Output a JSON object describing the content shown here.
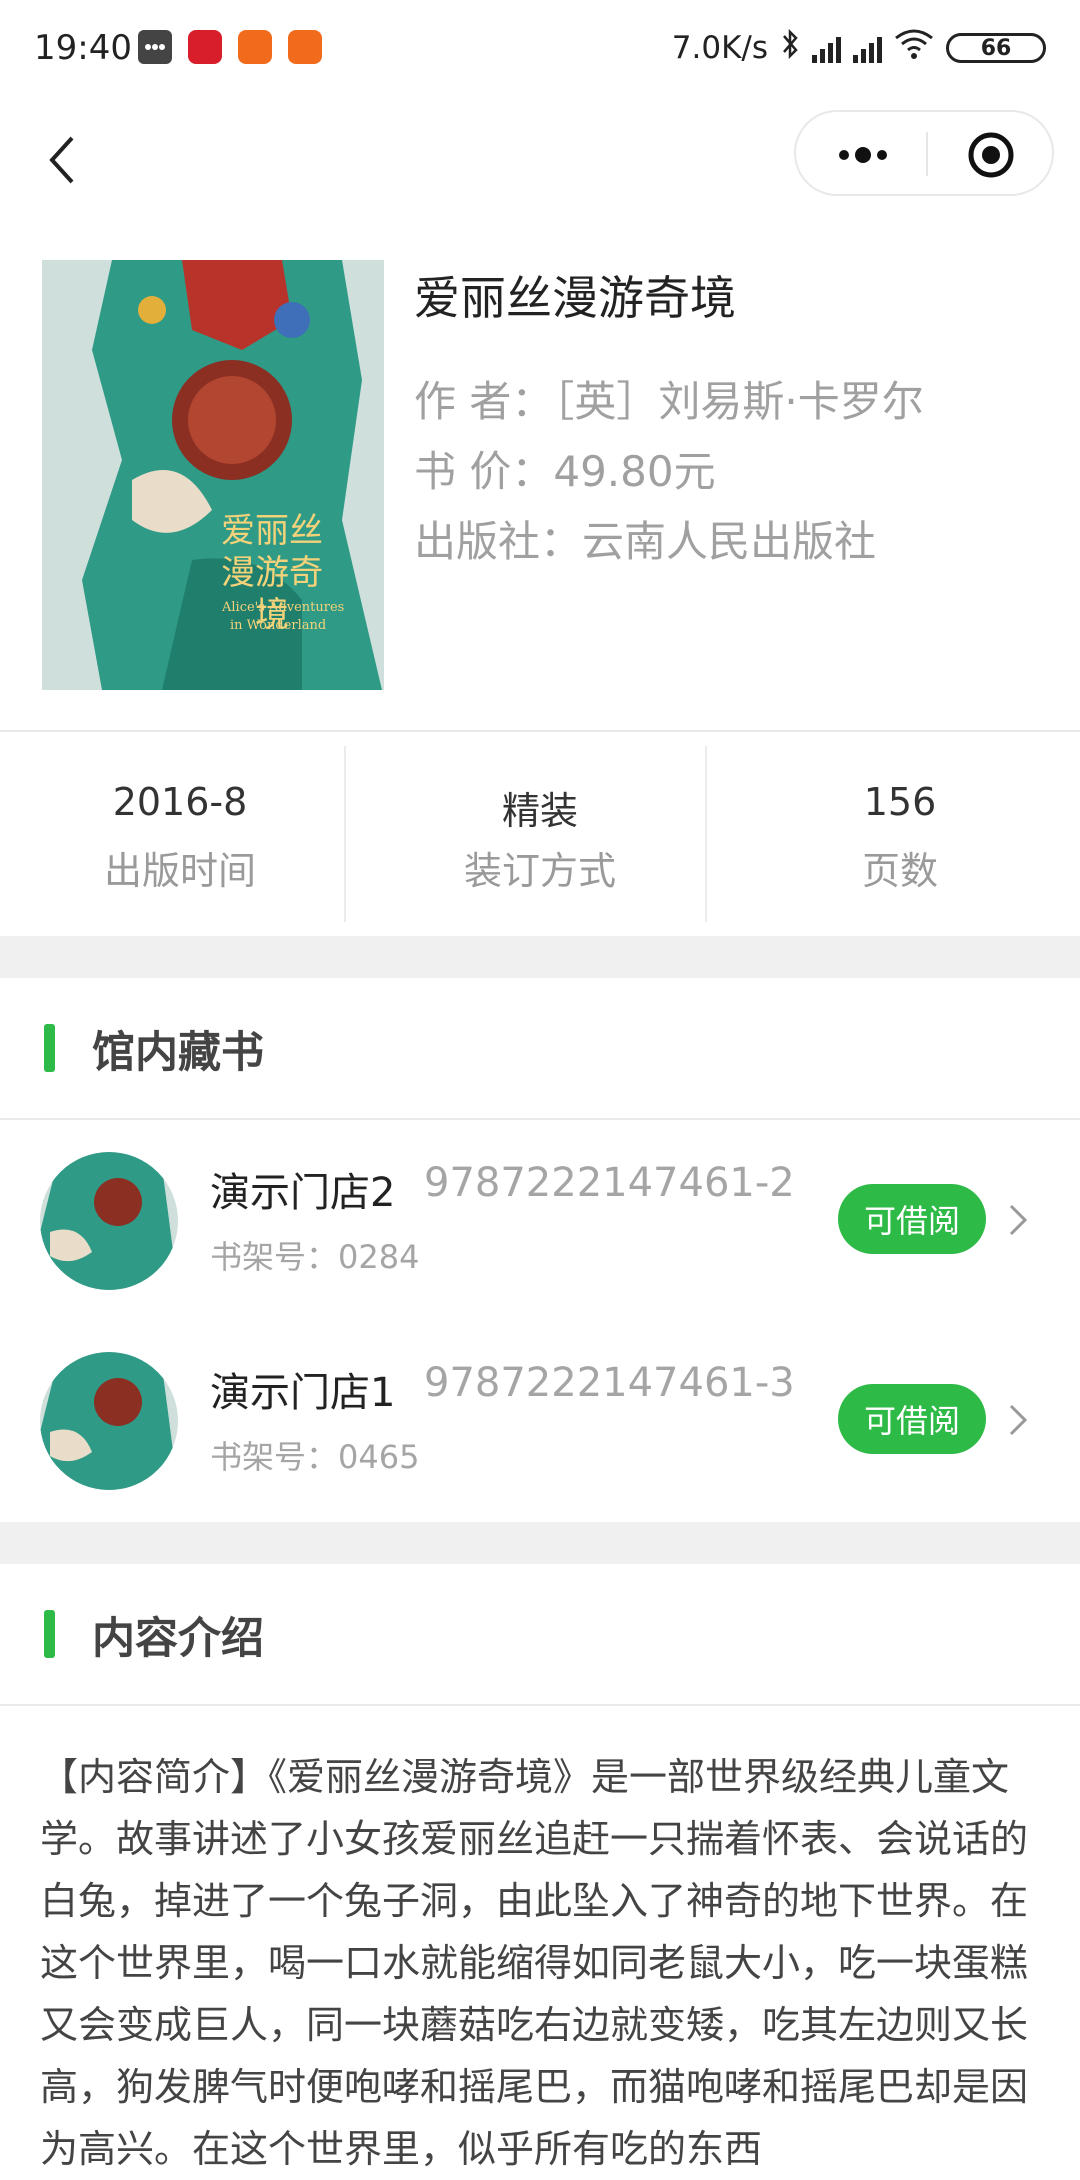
{
  "status_bar": {
    "time": "19:40",
    "network_speed": "7.0K/s",
    "battery": "66",
    "notification_icons": [
      "message-icon",
      "netease-icon",
      "mi-icon",
      "mi-icon"
    ]
  },
  "nav": {
    "back_icon": "chevron-left-icon",
    "menu_icon": "more-dots-icon",
    "close_icon": "target-icon"
  },
  "book": {
    "title": "爱丽丝漫游奇境",
    "author": "作 者：［英］刘易斯·卡罗尔",
    "price": "书 价：49.80元",
    "publisher": "出版社：云南人民出版社",
    "cover": {
      "title_cn": "爱丽丝漫游奇境",
      "title_en_1": "Alice's Adventures",
      "title_en_2": "in Wonderland"
    }
  },
  "stats": [
    {
      "value": "2016-8",
      "label": "出版时间"
    },
    {
      "value": "精装",
      "label": "装订方式"
    },
    {
      "value": "156",
      "label": "页数"
    }
  ],
  "holdings": {
    "title": "馆内藏书",
    "items": [
      {
        "branch": "演示门店2",
        "code": "9787222147461-2",
        "shelf": "书架号：0284",
        "status": "可借阅"
      },
      {
        "branch": "演示门店1",
        "code": "9787222147461-3",
        "shelf": "书架号：0465",
        "status": "可借阅"
      }
    ]
  },
  "intro": {
    "title": "内容介绍",
    "text": "【内容简介】《爱丽丝漫游奇境》是一部世界级经典儿童文学。故事讲述了小女孩爱丽丝追赶一只揣着怀表、会说话的白兔，掉进了一个兔子洞，由此坠入了神奇的地下世界。在这个世界里，喝一口水就能缩得如同老鼠大小，吃一块蛋糕又会变成巨人，同一块蘑菇吃右边就变矮，吃其左边则又长高，狗发脾气时便咆哮和摇尾巴，而猫咆哮和摇尾巴却是因为高兴。在这个世界里，似乎所有吃的东西"
  },
  "colors": {
    "accent": "#2dba46",
    "divider": "#e9e9e9",
    "section_gap": "#f0f0f0"
  }
}
